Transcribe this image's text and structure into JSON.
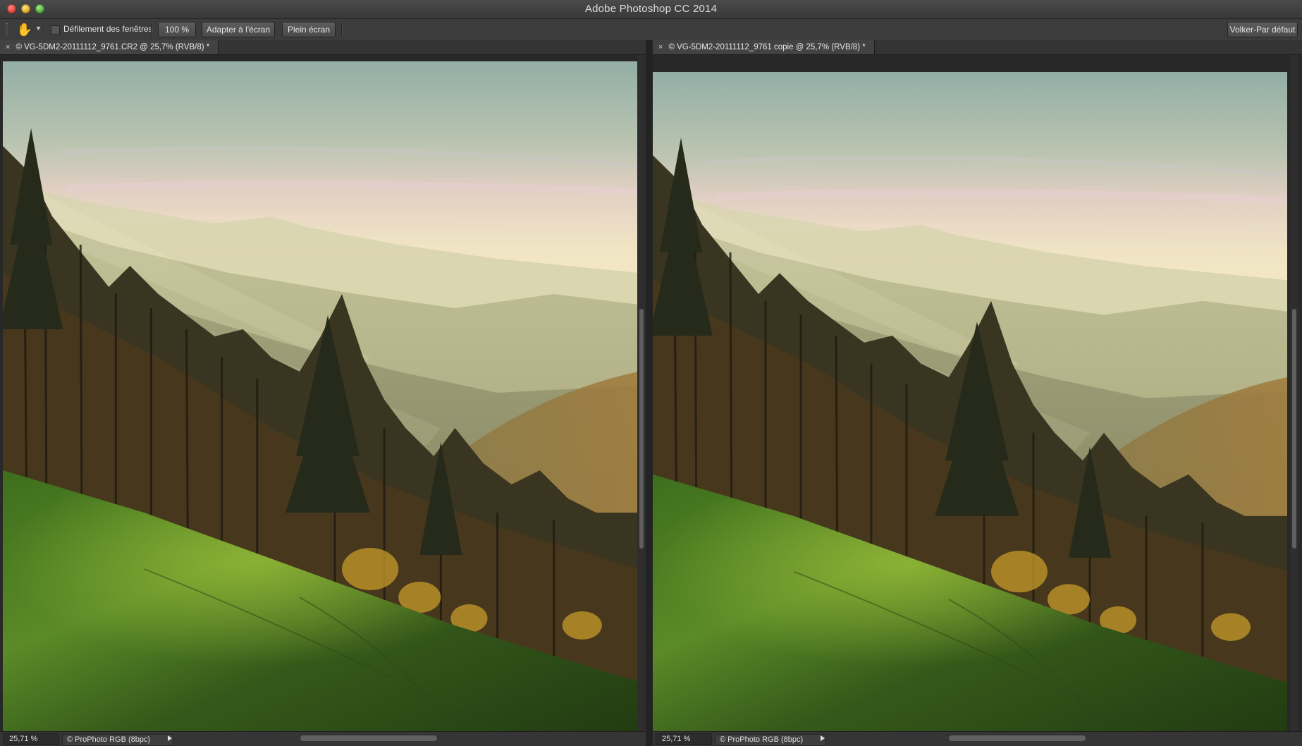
{
  "window": {
    "title": "Adobe Photoshop CC 2014"
  },
  "options_bar": {
    "tool_icon": "hand-icon",
    "scroll_all_windows_label": "Défilement des fenêtres",
    "scroll_all_windows_checked": false,
    "zoom_100_label": "100 %",
    "fit_screen_label": "Adapter à l'écran",
    "fill_screen_label": "Plein écran",
    "workspace_label": "Volker-Par défaut"
  },
  "documents": [
    {
      "tab_close": "×",
      "tab_title": "© VG-5DM2-20111112_9761.CR2 @ 25,7% (RVB/8) *",
      "zoom": "25,71 %",
      "color_profile": "© ProPhoto RGB (8bpc)"
    },
    {
      "tab_close": "×",
      "tab_title": "© VG-5DM2-20111112_9761 copie @ 25,7% (RVB/8) *",
      "zoom": "25,71 %",
      "color_profile": "© ProPhoto RGB (8bpc)"
    }
  ],
  "colors": {
    "ui_dark": "#2b2b2b",
    "ui_panel": "#3c3c3c",
    "sky_top": "#9fb3a8",
    "haze": "#f3e6c0",
    "meadow": "#3f6a1f"
  }
}
